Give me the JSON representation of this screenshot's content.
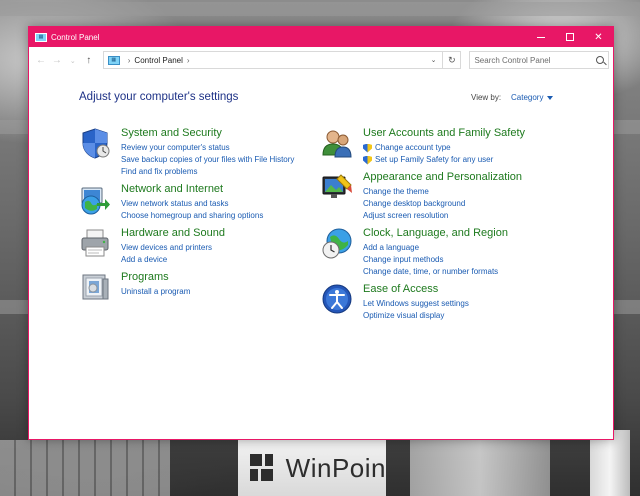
{
  "window": {
    "title": "Control Panel",
    "icon": "control-panel-icon"
  },
  "address_bar": {
    "path": [
      "Control Panel"
    ],
    "search_placeholder": "Search Control Panel"
  },
  "main": {
    "heading": "Adjust your computer's settings",
    "view_by_label": "View by:",
    "view_by_value": "Category",
    "left_column": [
      {
        "title": "System and Security",
        "icon": "shield-icon",
        "links": [
          "Review your computer's status",
          "Save backup copies of your files with File History",
          "Find and fix problems"
        ]
      },
      {
        "title": "Network and Internet",
        "icon": "network-globe-icon",
        "links": [
          "View network status and tasks",
          "Choose homegroup and sharing options"
        ]
      },
      {
        "title": "Hardware and Sound",
        "icon": "printer-icon",
        "links": [
          "View devices and printers",
          "Add a device"
        ]
      },
      {
        "title": "Programs",
        "icon": "programs-icon",
        "links": [
          "Uninstall a program"
        ]
      }
    ],
    "right_column": [
      {
        "title": "User Accounts and Family Safety",
        "icon": "users-icon",
        "links": [
          "Change account type",
          "Set up Family Safety for any user"
        ]
      },
      {
        "title": "Appearance and Personalization",
        "icon": "appearance-icon",
        "links": [
          "Change the theme",
          "Change desktop background",
          "Adjust screen resolution"
        ]
      },
      {
        "title": "Clock, Language, and Region",
        "icon": "clock-globe-icon",
        "links": [
          "Add a language",
          "Change input methods",
          "Change date, time, or number formats"
        ]
      },
      {
        "title": "Ease of Access",
        "icon": "ease-of-access-icon",
        "links": [
          "Let Windows suggest settings",
          "Optimize visual display"
        ]
      }
    ]
  },
  "watermark": {
    "text": "WinPoin"
  },
  "colors": {
    "accent": "#e81766",
    "category_title": "#1e7a1e",
    "link": "#1a5bb2",
    "heading": "#1e3287"
  }
}
